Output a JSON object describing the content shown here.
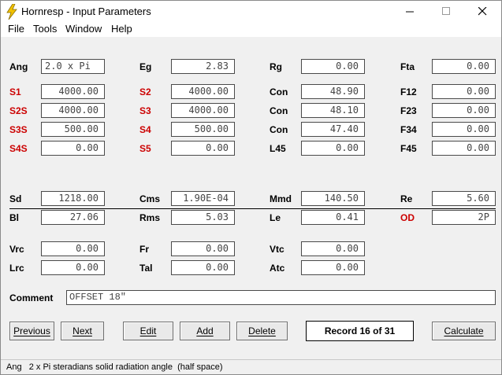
{
  "window": {
    "title": "Hornresp - Input Parameters",
    "accent": "#f0f0f0"
  },
  "menu": [
    "File",
    "Tools",
    "Window",
    "Help"
  ],
  "rows": {
    "r1": [
      [
        "Ang",
        "2.0 x Pi",
        false
      ],
      [
        "Eg",
        "2.83",
        false
      ],
      [
        "Rg",
        "0.00",
        false
      ],
      [
        "Fta",
        "0.00",
        false
      ]
    ],
    "r2": [
      [
        "S1",
        "4000.00",
        true
      ],
      [
        "S2",
        "4000.00",
        true
      ],
      [
        "Con",
        "48.90",
        false
      ],
      [
        "F12",
        "0.00",
        false
      ]
    ],
    "r3": [
      [
        "S2S",
        "4000.00",
        true
      ],
      [
        "S3",
        "4000.00",
        true
      ],
      [
        "Con",
        "48.10",
        false
      ],
      [
        "F23",
        "0.00",
        false
      ]
    ],
    "r4": [
      [
        "S3S",
        "500.00",
        true
      ],
      [
        "S4",
        "500.00",
        true
      ],
      [
        "Con",
        "47.40",
        false
      ],
      [
        "F34",
        "0.00",
        false
      ]
    ],
    "r5": [
      [
        "S4S",
        "0.00",
        true
      ],
      [
        "S5",
        "0.00",
        true
      ],
      [
        "L45",
        "0.00",
        false
      ],
      [
        "F45",
        "0.00",
        false
      ]
    ],
    "r6": [
      [
        "Sd",
        "1218.00",
        false
      ],
      [
        "Cms",
        "1.90E-04",
        false
      ],
      [
        "Mmd",
        "140.50",
        false
      ],
      [
        "Re",
        "5.60",
        false
      ]
    ],
    "r7": [
      [
        "Bl",
        "27.06",
        false
      ],
      [
        "Rms",
        "5.03",
        false
      ],
      [
        "Le",
        "0.41",
        false
      ],
      [
        "OD",
        "2P",
        true
      ]
    ],
    "r8": [
      [
        "Vrc",
        "0.00",
        false
      ],
      [
        "Fr",
        "0.00",
        false
      ],
      [
        "Vtc",
        "0.00",
        false
      ]
    ],
    "r9": [
      [
        "Lrc",
        "0.00",
        false
      ],
      [
        "Tal",
        "0.00",
        false
      ],
      [
        "Atc",
        "0.00",
        false
      ]
    ]
  },
  "comment": {
    "label": "Comment",
    "value": "OFFSET 18\""
  },
  "buttons": {
    "previous": "Previous",
    "next": "Next",
    "edit": "Edit",
    "add": "Add",
    "delete": "Delete",
    "calculate": "Calculate"
  },
  "record": "Record 16 of 31",
  "status": "Ang   2 x Pi steradians solid radiation angle  (half space)",
  "colors": {
    "label_red": "#cc0000",
    "icon_yellow": "#f2c200"
  }
}
